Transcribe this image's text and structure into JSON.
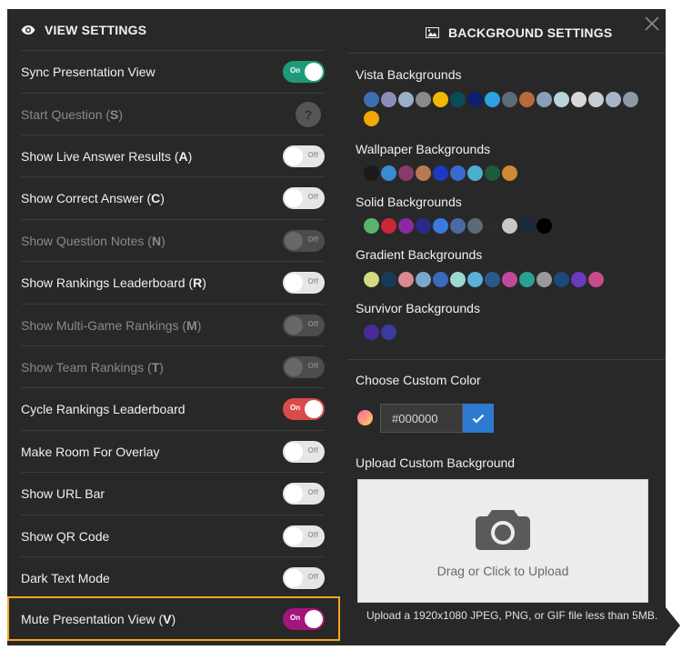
{
  "view_settings": {
    "title": "VIEW SETTINGS",
    "rows": [
      {
        "label": "Sync Presentation View",
        "key": "",
        "state": "on",
        "color": "#1f9a78",
        "toggle_text": "On",
        "dim": false
      },
      {
        "label": "Start Question (",
        "key": "S",
        "state": "help",
        "toggle_text": "?",
        "dim": true
      },
      {
        "label": "Show Live Answer Results (",
        "key": "A",
        "state": "off",
        "toggle_text": "Off",
        "dim": false
      },
      {
        "label": "Show Correct Answer (",
        "key": "C",
        "state": "off",
        "toggle_text": "Off",
        "dim": false
      },
      {
        "label": "Show Question Notes (",
        "key": "N",
        "state": "off",
        "toggle_text": "Off",
        "dim": true
      },
      {
        "label": "Show Rankings Leaderboard (",
        "key": "R",
        "state": "off",
        "toggle_text": "Off",
        "dim": false
      },
      {
        "label": "Show Multi-Game Rankings (",
        "key": "M",
        "state": "off",
        "toggle_text": "Off",
        "dim": true
      },
      {
        "label": "Show Team Rankings (",
        "key": "T",
        "state": "off",
        "toggle_text": "Off",
        "dim": true
      },
      {
        "label": "Cycle Rankings Leaderboard",
        "key": "",
        "state": "on",
        "color": "#d94a4a",
        "toggle_text": "On",
        "dim": false
      },
      {
        "label": "Make Room For Overlay",
        "key": "",
        "state": "off",
        "toggle_text": "Off",
        "dim": false
      },
      {
        "label": "Show URL Bar",
        "key": "",
        "state": "off",
        "toggle_text": "Off",
        "dim": false
      },
      {
        "label": "Show QR Code",
        "key": "",
        "state": "off",
        "toggle_text": "Off",
        "dim": false
      },
      {
        "label": "Dark Text Mode",
        "key": "",
        "state": "off",
        "toggle_text": "Off",
        "dim": false
      },
      {
        "label": "Mute Presentation View (",
        "key": "V",
        "state": "on",
        "color": "#a3157a",
        "toggle_text": "On",
        "dim": false
      }
    ]
  },
  "background_settings": {
    "title": "BACKGROUND SETTINGS",
    "vista_label": "Vista Backgrounds",
    "vista_colors": [
      "#3d6fb0",
      "#8b8fb8",
      "#9bb0c8",
      "#8a8a8a",
      "#f2b800",
      "#0c4a5a",
      "#0e1f6e",
      "#2fa0e0",
      "#5d6b78",
      "#b86a3c",
      "#86a0b8",
      "#b9d3d8",
      "#d8d8d8",
      "#c8ccd4",
      "#a8b4c8",
      "#8a9aa8",
      "#f2a800"
    ],
    "wallpaper_label": "Wallpaper Backgrounds",
    "wallpaper_colors": [
      "#1a1a1a",
      "#3a8bd0",
      "#8a3a6a",
      "#b87a50",
      "#1a3ac0",
      "#3a6ad0",
      "#4ab0d0",
      "#1e5a3a",
      "#d08a30"
    ],
    "solid_label": "Solid Backgrounds",
    "solid_colors": [
      "#5bb36a",
      "#c8283a",
      "#8a2aa0",
      "#2a2a8a",
      "#3a7ae0",
      "#4a6aa0",
      "#5a6a7a",
      "#2a2a2a",
      "#c8c8c8",
      "#1a2a3a",
      "#000000"
    ],
    "gradient_label": "Gradient Backgrounds",
    "gradient_colors": [
      "#d4d880",
      "#1a3a5a",
      "#d88a90",
      "#7aa8c8",
      "#3a6ac0",
      "#9ad8d0",
      "#5ab0d8",
      "#2a5a8a",
      "#c04a9a",
      "#2aa090",
      "#9a9a9a",
      "#1a4a7a",
      "#6a3ac0",
      "#c84a8a"
    ],
    "survivor_label": "Survivor Backgrounds",
    "survivor_colors": [
      "#4a2a9a",
      "#3a3aa0"
    ],
    "custom_color_label": "Choose Custom Color",
    "custom_color_value": "#000000",
    "upload_label": "Upload Custom Background",
    "upload_prompt": "Drag or Click to Upload",
    "upload_note": "Upload a 1920x1080 JPEG, PNG, or GIF file less than 5MB."
  }
}
